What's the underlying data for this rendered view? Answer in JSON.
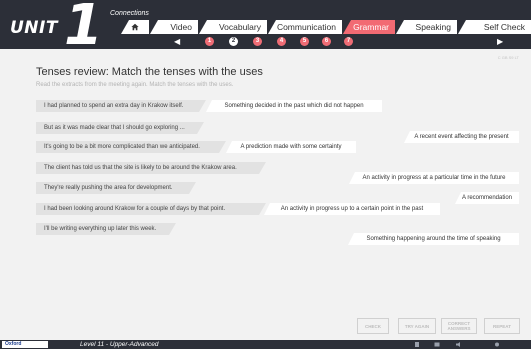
{
  "header": {
    "unit_label": "UNIT",
    "unit_number": "1",
    "section_title": "Connections",
    "tabs": [
      {
        "label": "",
        "icon": "home-icon"
      },
      {
        "label": "Video"
      },
      {
        "label": "Vocabulary"
      },
      {
        "label": "Communication"
      },
      {
        "label": "Grammar",
        "active": true
      },
      {
        "label": "Speaking"
      },
      {
        "label": "Self Check"
      }
    ],
    "steps": [
      "1",
      "2",
      "3",
      "4",
      "5",
      "6",
      "7"
    ],
    "current_step": "2"
  },
  "content": {
    "watermark": "C GB S9 LT",
    "title": "Tenses review: Match the tenses with the uses",
    "instruction": "Read the extracts from the meeting again. Match the tenses with the uses.",
    "sentences": [
      "I had planned to spend an extra day in Krakow itself.",
      "But as it was made clear that I should go exploring ...",
      "It's going to be a bit more complicated than we anticipated.",
      "The client has told us that the site is likely to be around the Krakow area.",
      "They're really pushing the area for development.",
      "I had been looking around Krakow for a couple of days by that point.",
      "I'll be writing everything up later this week."
    ],
    "uses": [
      "Something decided in the past which did not happen",
      "A recent event affecting the present",
      "A prediction made with some certainty",
      "An activity in progress at a particular time in the future",
      "A recommendation",
      "An activity in progress up to a certain point in the past",
      "Something happening around the time of speaking"
    ]
  },
  "buttons": {
    "check": "CHECK",
    "try_again": "TRY AGAIN",
    "correct_answers": "CORRECT ANSWERS",
    "repeat": "REPEAT"
  },
  "footer": {
    "logo": "Oxford",
    "level": "Level 11 - Upper-Advanced"
  },
  "colors": {
    "header_bg": "#2c2f38",
    "accent": "#f26a73",
    "content_bg": "#f2f2f2"
  }
}
